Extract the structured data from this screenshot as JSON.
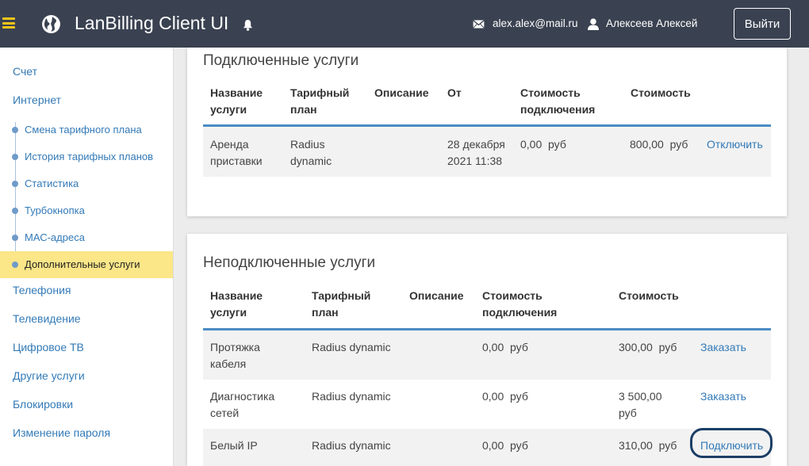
{
  "header": {
    "app_title": "LanBilling Client UI",
    "email": "alex.alex@mail.ru",
    "username": "Алексеев Алексей",
    "logout_label": "Выйти",
    "icons": [
      "hamburger-icon",
      "globe-icon",
      "bell-icon",
      "mail-icon",
      "user-icon"
    ],
    "colors": {
      "bar": "#3a4251",
      "menu_accent": "#f5c518"
    }
  },
  "sidebar": {
    "items": [
      {
        "label": "Счет"
      },
      {
        "label": "Интернет"
      },
      {
        "label": "Телефония"
      },
      {
        "label": "Телевидение"
      },
      {
        "label": "Цифровое ТВ"
      },
      {
        "label": "Другие услуги"
      },
      {
        "label": "Блокировки"
      },
      {
        "label": "Изменение пароля"
      }
    ],
    "internet_sub": [
      {
        "label": "Смена тарифного плана"
      },
      {
        "label": "История тарифных планов"
      },
      {
        "label": "Статистика"
      },
      {
        "label": "Турбокнопка"
      },
      {
        "label": "МАС-адреса"
      },
      {
        "label": "Дополнительные услуги",
        "active": true
      }
    ],
    "colors": {
      "active_bg": "#fbe688",
      "link": "#337ab7"
    }
  },
  "connected": {
    "title": "Подключенные услуги",
    "columns": [
      "Название услуги",
      "Тарифный план",
      "Описание",
      "От",
      "Стоимость подключения",
      "Стоимость"
    ],
    "rows": [
      {
        "name": "Аренда приставки",
        "plan": "Radius dynamic",
        "description": "",
        "from": "28 декабря 2021 11:38",
        "connection_cost": "0,00  руб",
        "cost": "800,00  руб",
        "action": "Отключить"
      }
    ]
  },
  "unconnected": {
    "title": "Неподключенные услуги",
    "columns": [
      "Название услуги",
      "Тарифный план",
      "Описание",
      "Стоимость подключения",
      "Стоимость"
    ],
    "rows": [
      {
        "name": "Протяжка кабеля",
        "plan": "Radius dynamic",
        "description": "",
        "connection_cost": "0,00  руб",
        "cost": "300,00  руб",
        "action": "Заказать"
      },
      {
        "name": "Диагностика сетей",
        "plan": "Radius dynamic",
        "description": "",
        "connection_cost": "0,00  руб",
        "cost": "3 500,00 руб",
        "action": "Заказать"
      },
      {
        "name": "Белый IP",
        "plan": "Radius dynamic",
        "description": "",
        "connection_cost": "0,00  руб",
        "cost": "310,00  руб",
        "action": "Подключить"
      }
    ]
  },
  "table_rule_color": "#4a8cc4"
}
